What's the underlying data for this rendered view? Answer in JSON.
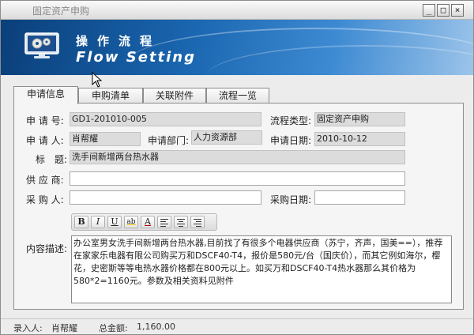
{
  "window": {
    "title": "固定资产申购",
    "min": "_",
    "max": "□",
    "close": "×"
  },
  "banner": {
    "title_cn": "操作流程",
    "title_en": "Flow Setting"
  },
  "tabs": [
    {
      "label": "申请信息"
    },
    {
      "label": "申购清单"
    },
    {
      "label": "关联附件"
    },
    {
      "label": "流程一览"
    }
  ],
  "form": {
    "apply_no": {
      "label": "申 请 号:",
      "value": "GD1-201010-005"
    },
    "flow_type": {
      "label": "流程类型:",
      "value": "固定资产申购"
    },
    "applicant": {
      "label": "申 请 人:",
      "value": "肖帮耀"
    },
    "dept": {
      "label": "申请部门:",
      "value": "人力资源部"
    },
    "apply_date": {
      "label": "申请日期:",
      "value": "2010-10-12"
    },
    "subject": {
      "label": "标　题:",
      "value": "洗手间新增两台热水器"
    },
    "supplier": {
      "label": "供 应 商:",
      "value": ""
    },
    "buyer": {
      "label": "采 购 人:",
      "value": ""
    },
    "buy_date": {
      "label": "采购日期:",
      "value": ""
    },
    "description": {
      "label": "内容描述:",
      "value": "办公室男女洗手间新增两台热水器,目前找了有很多个电器供应商（苏宁，齐声，国美==），推荐在家家乐电器有限公司购买万和DSCF40-T4，报价是580元/台（国庆价），而其它例如海尔，樱花，史密斯等等电热水器价格都在800元以上。如买万和DSCF40-T4热水器那么其价格为580*2=1160元。参数及相关资料见附件"
    }
  },
  "toolbar": {
    "bold": "B",
    "italic": "I",
    "underline": "U",
    "highlight": "ab",
    "font_color": "A"
  },
  "status": {
    "recorder_label": "录入人:",
    "recorder": "肖帮耀",
    "total_label": "总金额:",
    "total": "1,160.00"
  }
}
